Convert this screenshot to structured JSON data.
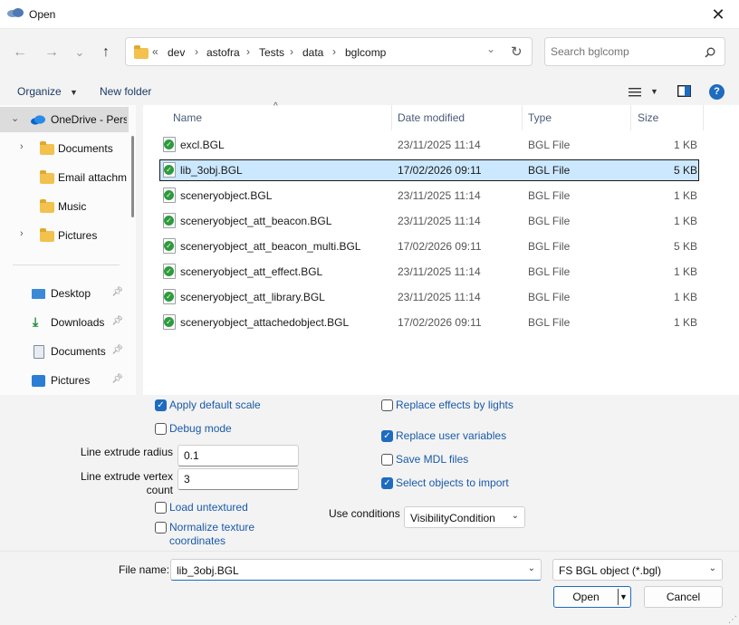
{
  "window": {
    "title": "Open",
    "close_glyph": "✕"
  },
  "nav": {
    "back_glyph": "←",
    "forward_glyph": "→",
    "recent_glyph": "⌄",
    "up_glyph": "↑",
    "address_prefix": "«",
    "breadcrumbs": [
      "dev",
      "astofra",
      "Tests",
      "data",
      "bglcomp"
    ],
    "refresh_glyph": "↻",
    "search_placeholder": "Search bglcomp"
  },
  "toolbar": {
    "organize": "Organize",
    "new_folder": "New folder",
    "help": "?"
  },
  "navpane": {
    "items": [
      {
        "label": "OneDrive - Pers",
        "icon": "cloud-icon",
        "selected": true
      },
      {
        "label": "Documents",
        "icon": "folder-icon"
      },
      {
        "label": "Email attachm",
        "icon": "folder-icon"
      },
      {
        "label": "Music",
        "icon": "folder-icon"
      },
      {
        "label": "Pictures",
        "icon": "folder-icon"
      },
      {
        "label": "Desktop",
        "icon": "desktop-icon",
        "pinned": true
      },
      {
        "label": "Downloads",
        "icon": "download-icon",
        "pinned": true
      },
      {
        "label": "Documents",
        "icon": "document-icon",
        "pinned": true
      },
      {
        "label": "Pictures",
        "icon": "picture-icon",
        "pinned": true
      }
    ]
  },
  "filelist": {
    "columns": {
      "name": "Name",
      "date": "Date modified",
      "type": "Type",
      "size": "Size"
    },
    "rows": [
      {
        "name": "excl.BGL",
        "date": "23/11/2025 11:14",
        "type": "BGL File",
        "size": "1 KB"
      },
      {
        "name": "lib_3obj.BGL",
        "date": "17/02/2026 09:11",
        "type": "BGL File",
        "size": "5 KB",
        "selected": true
      },
      {
        "name": "sceneryobject.BGL",
        "date": "23/11/2025 11:14",
        "type": "BGL File",
        "size": "1 KB"
      },
      {
        "name": "sceneryobject_att_beacon.BGL",
        "date": "23/11/2025 11:14",
        "type": "BGL File",
        "size": "1 KB"
      },
      {
        "name": "sceneryobject_att_beacon_multi.BGL",
        "date": "17/02/2026 09:11",
        "type": "BGL File",
        "size": "5 KB"
      },
      {
        "name": "sceneryobject_att_effect.BGL",
        "date": "23/11/2025 11:14",
        "type": "BGL File",
        "size": "1 KB"
      },
      {
        "name": "sceneryobject_att_library.BGL",
        "date": "23/11/2025 11:14",
        "type": "BGL File",
        "size": "1 KB"
      },
      {
        "name": "sceneryobject_attachedobject.BGL",
        "date": "17/02/2026 09:11",
        "type": "BGL File",
        "size": "1 KB"
      }
    ]
  },
  "options": {
    "apply_default_scale": {
      "label": "Apply default scale",
      "checked": true
    },
    "debug_mode": {
      "label": "Debug mode",
      "checked": false
    },
    "line_extrude_radius": {
      "label": "Line extrude radius",
      "value": "0.1"
    },
    "line_extrude_vertex_count": {
      "label_line1": "Line extrude vertex",
      "label_line2": "count",
      "value": "3"
    },
    "load_untextured": {
      "label": "Load untextured",
      "checked": false
    },
    "normalize_texture_coordinates": {
      "label_line1": "Normalize texture",
      "label_line2": "coordinates",
      "checked": false
    },
    "replace_effects_by_lights": {
      "label": "Replace effects by lights",
      "checked": false
    },
    "replace_user_variables": {
      "label": "Replace user variables",
      "checked": true
    },
    "save_mdl_files": {
      "label": "Save MDL files",
      "checked": false
    },
    "select_objects_to_import": {
      "label": "Select objects to import",
      "checked": true
    },
    "use_conditions": {
      "label": "Use conditions",
      "value": "VisibilityCondition"
    }
  },
  "footer": {
    "file_name_label": "File name:",
    "file_name_value": "lib_3obj.BGL",
    "filter_value": "FS BGL object (*.bgl)",
    "open_label": "Open",
    "cancel_label": "Cancel"
  },
  "colors": {
    "accent": "#1f6bbf",
    "selection": "#cce8ff",
    "folder": "#f2c14e",
    "check_green": "#2e9b3c"
  }
}
